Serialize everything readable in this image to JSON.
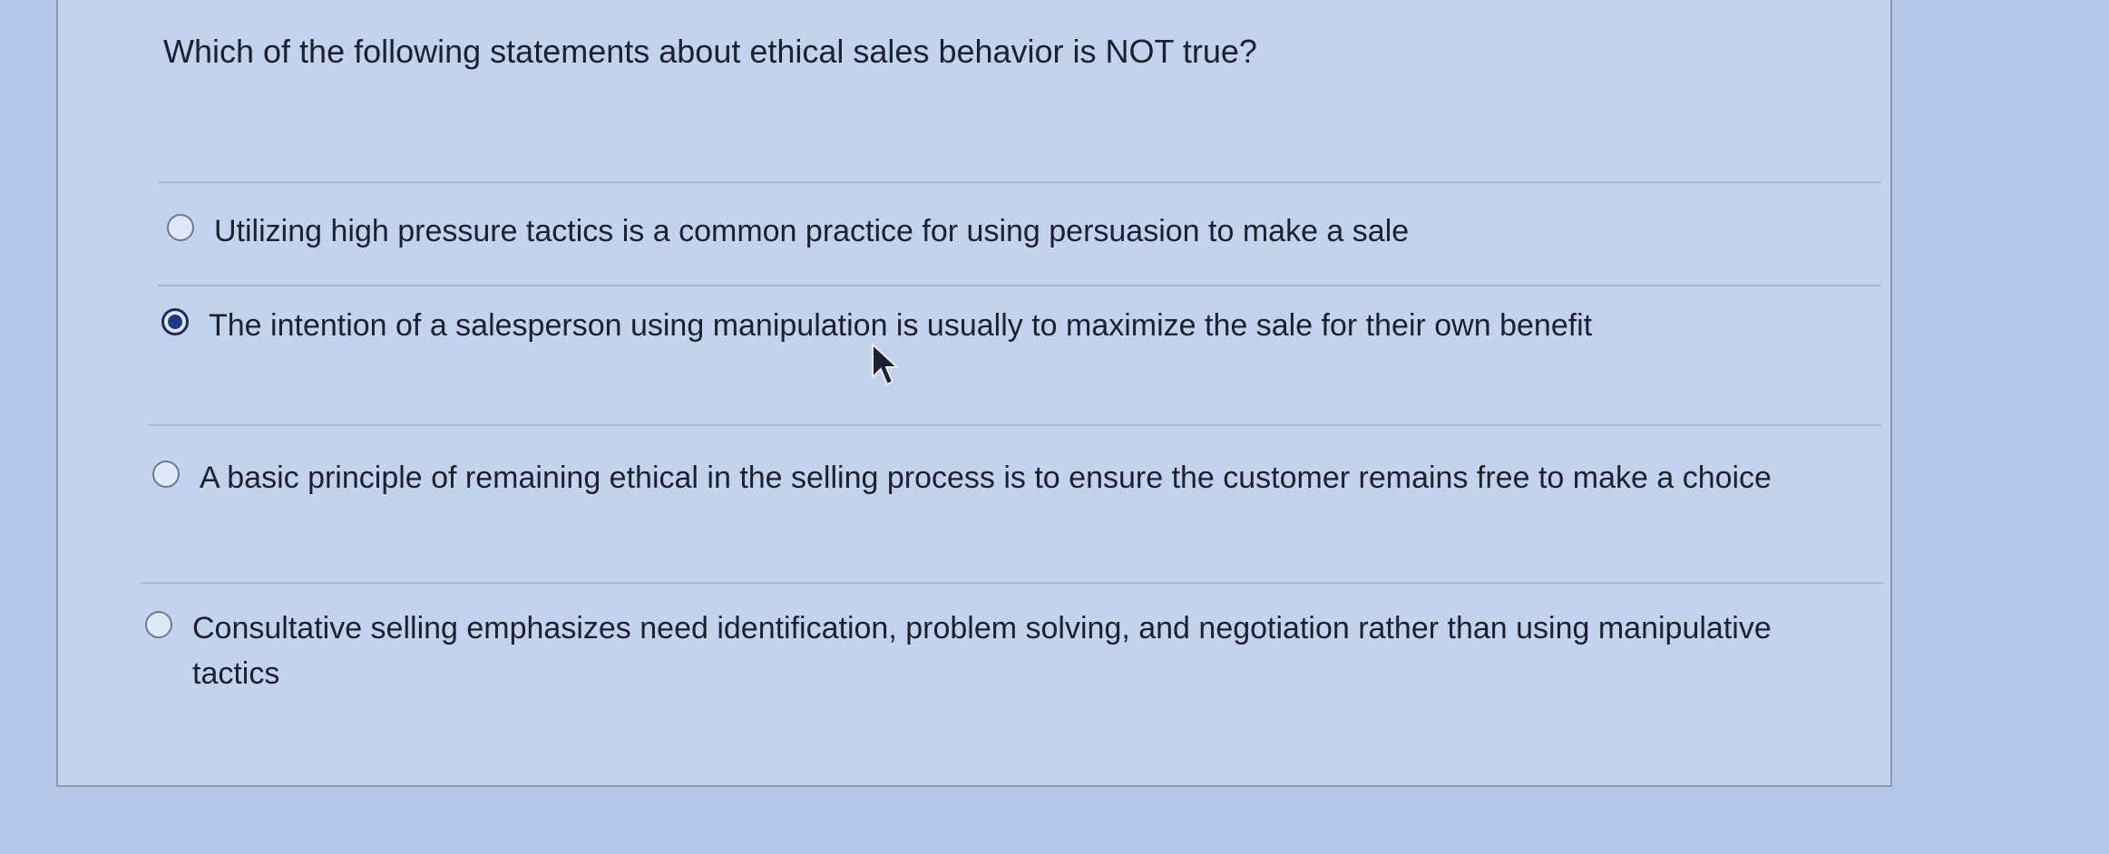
{
  "question": {
    "text": "Which of the following statements about ethical sales behavior is NOT true?"
  },
  "options": [
    {
      "label": "Utilizing high pressure tactics is a common practice for using persuasion to make a sale",
      "selected": false
    },
    {
      "label": "The intention of a salesperson using manipulation is usually to maximize the sale for their own benefit",
      "selected": true
    },
    {
      "label": "A basic principle of remaining ethical in the selling process is to ensure the customer remains free to make a choice",
      "selected": false
    },
    {
      "label": "Consultative selling emphasizes need identification, problem solving, and negotiation rather than using manipulative tactics",
      "selected": false
    }
  ],
  "colors": {
    "background": "#b4c7e6",
    "card": "#c3d3ee",
    "selected_radio": "#1f3a8a",
    "text": "#1c2130"
  },
  "icons": {
    "cursor": "mouse-pointer-arrow-icon"
  }
}
